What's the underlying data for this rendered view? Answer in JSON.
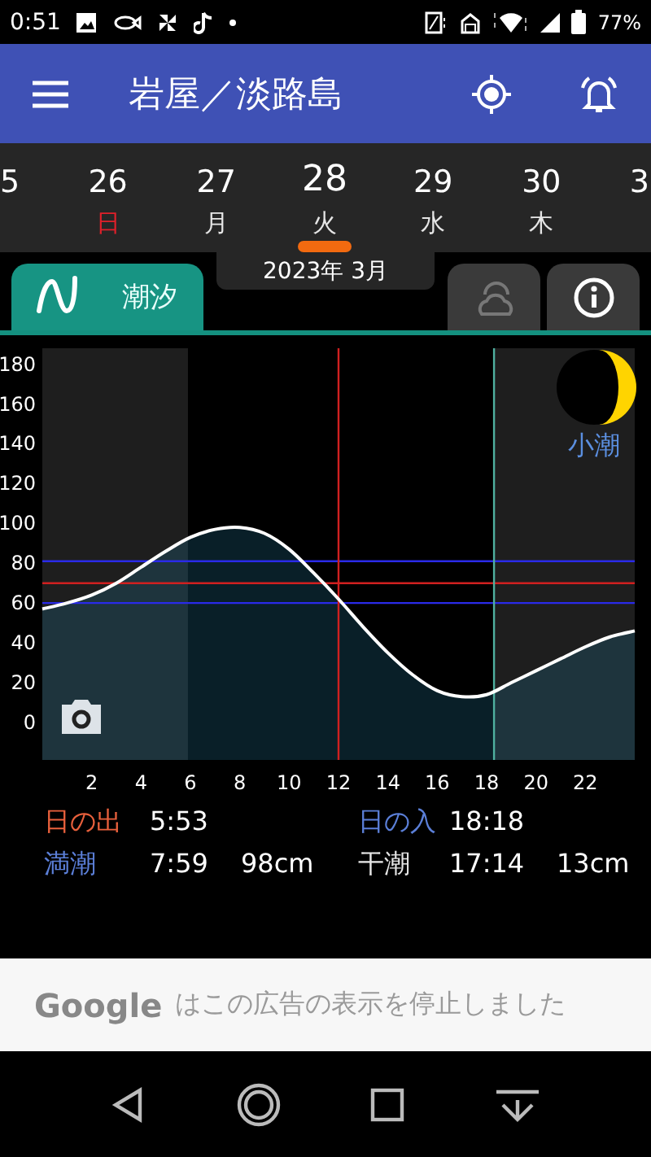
{
  "status_bar": {
    "time": "0:51",
    "battery": "77%"
  },
  "app_bar": {
    "title": "岩屋／淡路島"
  },
  "days": [
    {
      "day": "5",
      "selected": false
    },
    {
      "day": "26",
      "weekday": "日",
      "color": "#e0202a",
      "selected": false
    },
    {
      "day": "27",
      "weekday": "月",
      "color": "#e6e6e6",
      "selected": false
    },
    {
      "day": "28",
      "weekday": "火",
      "color": "#e6e6e6",
      "selected": true
    },
    {
      "day": "29",
      "weekday": "水",
      "color": "#e6e6e6",
      "selected": false
    },
    {
      "day": "30",
      "weekday": "木",
      "color": "#e6e6e6",
      "selected": false
    },
    {
      "day": "3",
      "selected": false
    }
  ],
  "month_label": "2023年 3月",
  "tabs": [
    {
      "kind": "tide",
      "label": "潮汐",
      "selected": true,
      "disabled": false
    },
    {
      "kind": "weather",
      "selected": false,
      "disabled": true
    },
    {
      "kind": "info",
      "selected": false,
      "disabled": false
    }
  ],
  "chart": {
    "moon_phase": "小潮",
    "chart_data": {
      "type": "line",
      "x": [
        0,
        1,
        2,
        3,
        4,
        5,
        6,
        7,
        8,
        9,
        10,
        11,
        12,
        13,
        14,
        15,
        16,
        17,
        18,
        19,
        20,
        21,
        22,
        23,
        24
      ],
      "series": [
        {
          "color": "#ffffff",
          "values": [
            57,
            60,
            64,
            70,
            78,
            86,
            93,
            97,
            98,
            95,
            87,
            75,
            62,
            48,
            35,
            24,
            16,
            13,
            14,
            20,
            26,
            32,
            38,
            43,
            46
          ]
        }
      ],
      "xlim": [
        0,
        24
      ],
      "ylim": [
        -18,
        188
      ],
      "xticks": [
        2,
        4,
        6,
        8,
        10,
        12,
        14,
        16,
        18,
        20,
        22
      ],
      "yticks": [
        0,
        20,
        40,
        60,
        80,
        100,
        120,
        140,
        160,
        180
      ],
      "bands": [
        {
          "axis": "x",
          "from": 0,
          "to": 5.9,
          "color": "#1e1e1e"
        },
        {
          "axis": "x",
          "from": 18.3,
          "to": 24,
          "color": "#1e1e1e"
        }
      ],
      "ref_lines": [
        {
          "axis": "y",
          "value": 81,
          "color": "#2a2ae8"
        },
        {
          "axis": "y",
          "value": 70,
          "color": "#d02020"
        },
        {
          "axis": "y",
          "value": 60,
          "color": "#2a2ae8"
        },
        {
          "axis": "x",
          "value": 12,
          "color": "#d02020"
        },
        {
          "axis": "x",
          "value": 18.3,
          "color": "#4fb0a0"
        }
      ]
    }
  },
  "events": [
    {
      "label": "日の出",
      "color": "#e8603c",
      "time": "5:53"
    },
    {
      "label": "日の入",
      "color": "#5b7fd8",
      "time": "18:18"
    },
    {
      "label": "満潮",
      "color": "#5b7fd8",
      "time": "7:59",
      "height": "98cm"
    },
    {
      "label": "干潮",
      "color": "#e6e6e6",
      "time": "17:14",
      "height": "13cm"
    }
  ],
  "ad": {
    "brand": "Google",
    "message": "はこの広告の表示を停止しました"
  }
}
